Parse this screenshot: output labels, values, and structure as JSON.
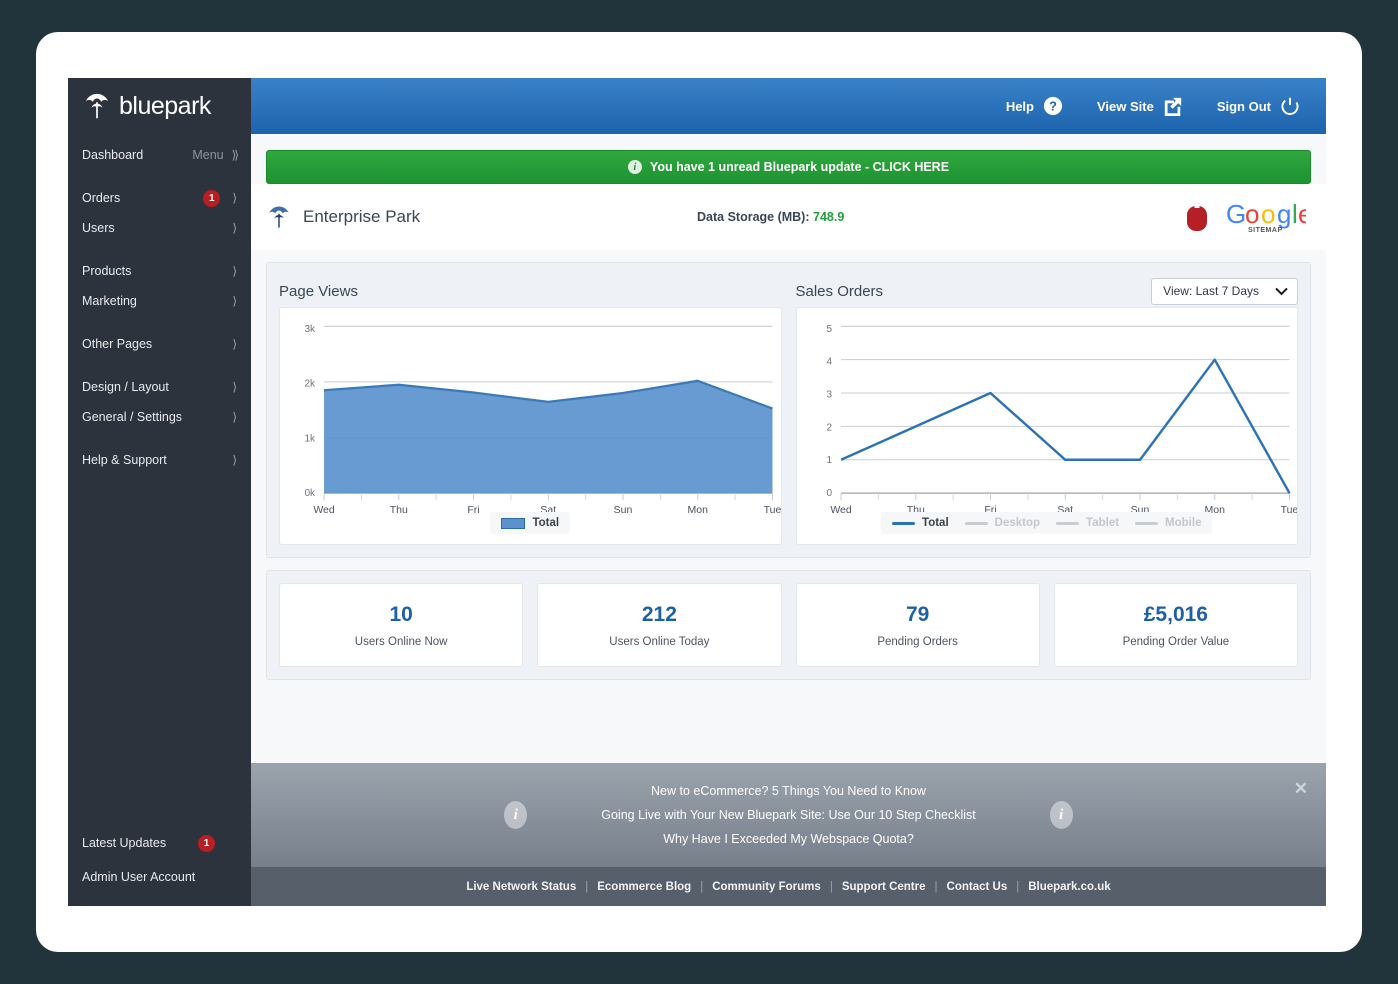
{
  "brand": {
    "name": "bluepark",
    "accent": "#1d63ad",
    "sidebar_bg": "#2c333d"
  },
  "sidebar": {
    "items": [
      {
        "label": "Dashboard",
        "sub": "Menu",
        "chevron": "⟩⟩",
        "badge": null
      },
      {
        "label": "Orders",
        "sub": "",
        "chevron": "⟩",
        "badge": "1"
      },
      {
        "label": "Users",
        "sub": "",
        "chevron": "⟩",
        "badge": null
      },
      {
        "label": "Products",
        "sub": "",
        "chevron": "⟩",
        "badge": null
      },
      {
        "label": "Marketing",
        "sub": "",
        "chevron": "⟩",
        "badge": null
      },
      {
        "label": "Other Pages",
        "sub": "",
        "chevron": "⟩",
        "badge": null
      },
      {
        "label": "Design / Layout",
        "sub": "",
        "chevron": "⟩",
        "badge": null
      },
      {
        "label": "General / Settings",
        "sub": "",
        "chevron": "⟩",
        "badge": null
      },
      {
        "label": "Help & Support",
        "sub": "",
        "chevron": "⟩",
        "badge": null
      }
    ],
    "bottom": [
      {
        "label": "Latest Updates",
        "badge": "1"
      },
      {
        "label": "Admin User Account",
        "badge": null
      }
    ]
  },
  "topbar": {
    "help": "Help",
    "view_site": "View Site",
    "sign_out": "Sign Out",
    "icons": [
      "question-mark-icon",
      "external-link-icon",
      "power-icon"
    ]
  },
  "notice": {
    "text": "You have 1 unread Bluepark update  -  CLICK HERE",
    "color": "#1e9332"
  },
  "page_head": {
    "site_name": "Enterprise Park",
    "storage_label": "Data Storage (MB):",
    "storage_value": "748.9",
    "logos": [
      "bluepark-mouse-icon",
      "google-sitemap-logo"
    ],
    "google_letters": [
      "G",
      "o",
      "o",
      "g",
      "l",
      "e"
    ],
    "google_sitemap_caption": "SITEMAP"
  },
  "charts": {
    "view_select": {
      "label": "View: Last 7 Days",
      "chevron": "chevron-down-icon"
    }
  },
  "chart_data": [
    {
      "type": "area",
      "title": "Page Views",
      "categories": [
        "Wed",
        "Thu",
        "Fri",
        "Sat",
        "Sun",
        "Mon",
        "Tue"
      ],
      "series": [
        {
          "name": "Total",
          "values": [
            1850,
            1950,
            1810,
            1640,
            1800,
            2020,
            1520
          ]
        }
      ],
      "ytick_labels": [
        "0k",
        "1k",
        "2k",
        "3k"
      ],
      "ytick_values": [
        0,
        1000,
        2000,
        3000
      ],
      "ylim": [
        0,
        3000
      ],
      "xlabel": "",
      "ylabel": "",
      "grid": true,
      "legend": [
        {
          "label": "Total",
          "style": "box",
          "active": true
        }
      ],
      "color": "#5b92cd",
      "line_color": "#3a7ab8"
    },
    {
      "type": "line",
      "title": "Sales Orders",
      "categories": [
        "Wed",
        "Thu",
        "Fri",
        "Sat",
        "Sun",
        "Mon",
        "Tue"
      ],
      "series": [
        {
          "name": "Total",
          "values": [
            1,
            2,
            3,
            1,
            1,
            4,
            0
          ]
        }
      ],
      "ytick_labels": [
        "0",
        "1",
        "2",
        "3",
        "4",
        "5"
      ],
      "ytick_values": [
        0,
        1,
        2,
        3,
        4,
        5
      ],
      "ylim": [
        0,
        5
      ],
      "xlabel": "",
      "ylabel": "",
      "grid": true,
      "legend": [
        {
          "label": "Total",
          "style": "line",
          "active": true
        },
        {
          "label": "Desktop",
          "style": "line",
          "active": false
        },
        {
          "label": "Tablet",
          "style": "line",
          "active": false
        },
        {
          "label": "Mobile",
          "style": "line",
          "active": false
        }
      ],
      "color": "#2c72b8"
    }
  ],
  "stats": [
    {
      "value": "10",
      "label": "Users Online Now"
    },
    {
      "value": "212",
      "label": "Users Online Today"
    },
    {
      "value": "79",
      "label": "Pending Orders"
    },
    {
      "value": "£5,016",
      "label": "Pending Order Value"
    }
  ],
  "promo": {
    "lines": [
      "New to eCommerce? 5 Things You Need to Know",
      "Going Live with Your New Bluepark Site: Use Our 10 Step Checklist",
      "Why Have I Exceeded My Webspace Quota?"
    ],
    "close": "✕",
    "info_glyph": "i"
  },
  "footer": {
    "links": [
      "Live Network Status",
      "Ecommerce Blog",
      "Community Forums",
      "Support Centre",
      "Contact Us",
      "Bluepark.co.uk"
    ],
    "separator": "|"
  }
}
